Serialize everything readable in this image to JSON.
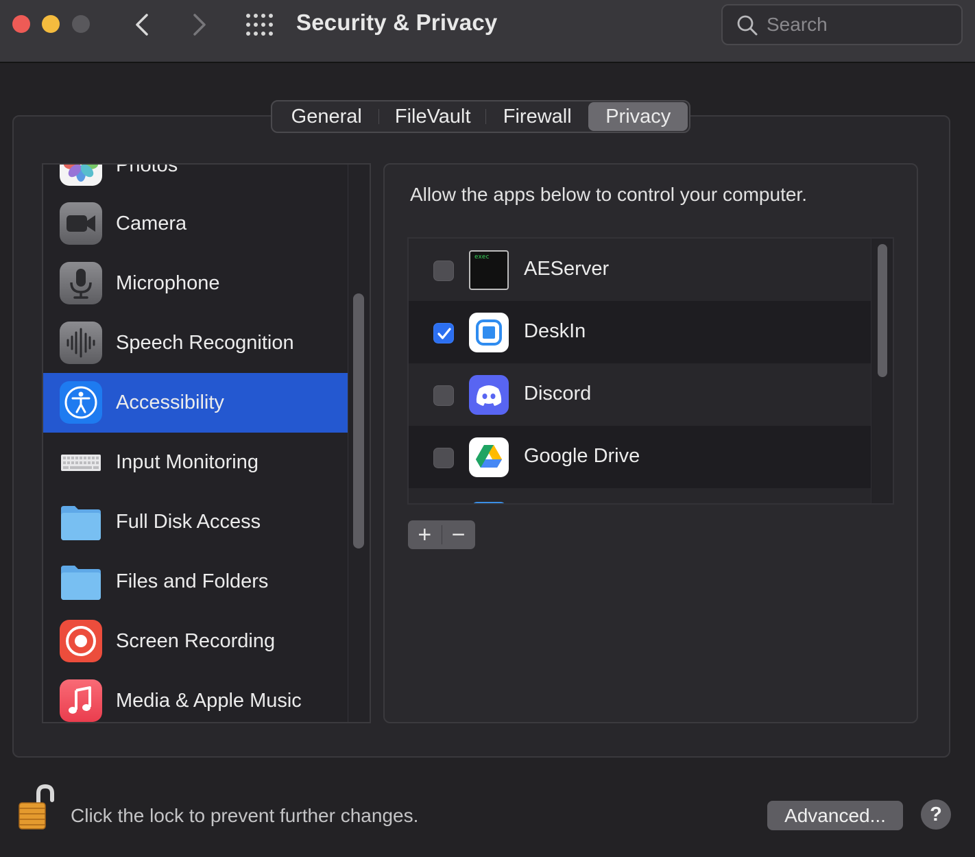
{
  "window": {
    "title": "Security & Privacy"
  },
  "search": {
    "placeholder": "Search",
    "value": ""
  },
  "tabs": [
    {
      "label": "General"
    },
    {
      "label": "FileVault"
    },
    {
      "label": "Firewall"
    },
    {
      "label": "Privacy",
      "selected": true
    }
  ],
  "sidebar": {
    "items": [
      {
        "label": "Photos",
        "icon": "photos-icon"
      },
      {
        "label": "Camera",
        "icon": "camera-icon"
      },
      {
        "label": "Microphone",
        "icon": "microphone-icon"
      },
      {
        "label": "Speech Recognition",
        "icon": "speech-recognition-icon"
      },
      {
        "label": "Accessibility",
        "icon": "accessibility-icon",
        "selected": true
      },
      {
        "label": "Input Monitoring",
        "icon": "keyboard-icon"
      },
      {
        "label": "Full Disk Access",
        "icon": "folder-icon"
      },
      {
        "label": "Files and Folders",
        "icon": "folder-icon"
      },
      {
        "label": "Screen Recording",
        "icon": "screen-recording-icon"
      },
      {
        "label": "Media & Apple Music",
        "icon": "music-icon"
      }
    ]
  },
  "detail": {
    "description": "Allow the apps below to control your computer.",
    "apps": [
      {
        "name": "AEServer",
        "checked": false,
        "icon": "terminal-exec-icon",
        "icon_text": "exec"
      },
      {
        "name": "DeskIn",
        "checked": true,
        "icon": "deskin-icon"
      },
      {
        "name": "Discord",
        "checked": false,
        "icon": "discord-icon"
      },
      {
        "name": "Google Drive",
        "checked": false,
        "icon": "google-drive-icon"
      }
    ],
    "add_symbol": "+",
    "remove_symbol": "−"
  },
  "footer": {
    "lock_text": "Click the lock to prevent further changes.",
    "advanced_label": "Advanced...",
    "help_label": "?"
  },
  "colors": {
    "selection": "#2458d0",
    "checkbox_checked": "#2c6ff0",
    "close": "#ee5b56",
    "minimize": "#f4bb3e"
  }
}
